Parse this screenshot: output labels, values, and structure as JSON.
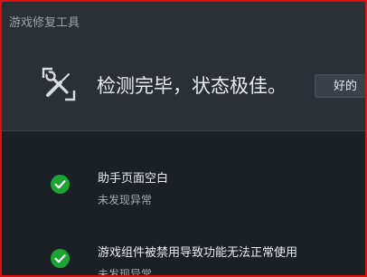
{
  "window": {
    "title": "游戏修复工具"
  },
  "summary": {
    "icon": "repair-tools-icon",
    "status_text": "检测完毕，状态极佳。",
    "ok_button_label": "好的"
  },
  "results": [
    {
      "icon": "check-circle-icon",
      "title": "助手页面空白",
      "status": "未发现异常"
    },
    {
      "icon": "check-circle-icon",
      "title": "游戏组件被禁用导致功能无法正常使用",
      "status": "未发现异常"
    }
  ],
  "colors": {
    "background": "#1b1f26",
    "header_panel": "#2b2f36",
    "success_green": "#1aa533",
    "frame_border": "#e01010"
  }
}
